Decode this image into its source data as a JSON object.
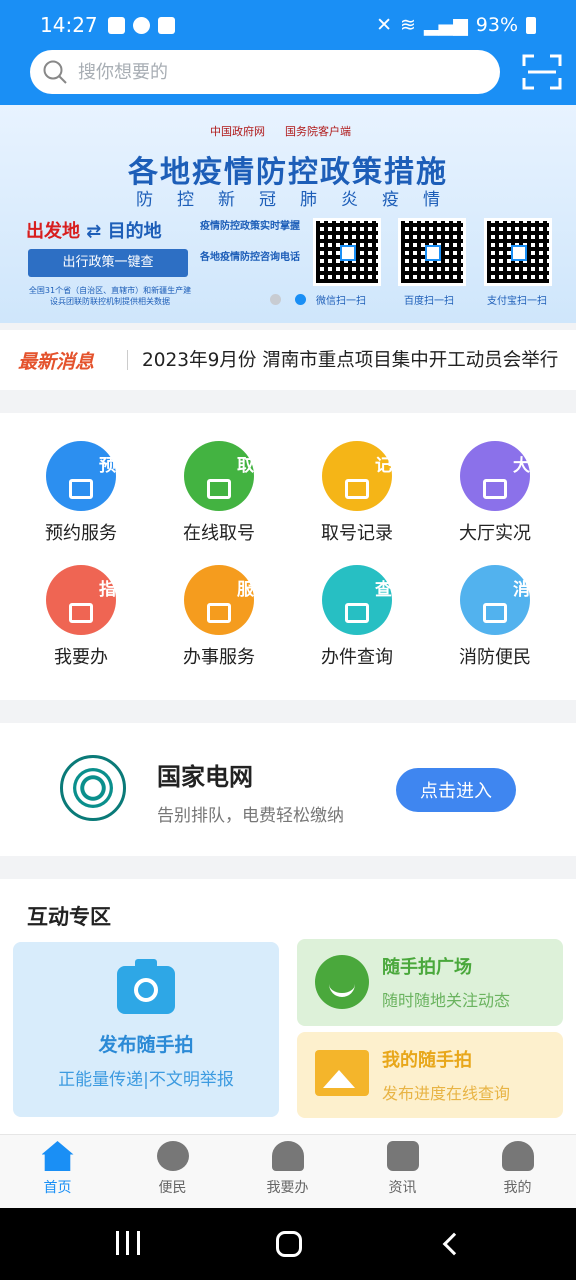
{
  "status_bar": {
    "time": "14:27",
    "battery": "93%"
  },
  "search": {
    "placeholder": "搜你想要的"
  },
  "banner": {
    "gov_site": "中国政府网",
    "state_council": "国务院客户端",
    "title": "各地疫情防控政策措施",
    "subtitle": "防控新冠肺炎疫情",
    "origin": "出发地",
    "destination": "目的地",
    "one_click": "出行政策一键查",
    "footnote": "全国31个省（自治区、直辖市）和新疆生产建设兵团联防联控机制提供相关数据",
    "policy_line": "疫情防控政策实时掌握",
    "phone_line": "各地疫情防控咨询电话",
    "qr_labels": [
      "微信扫一扫",
      "百度扫一扫",
      "支付宝扫一扫"
    ]
  },
  "news": {
    "tag": "最新消息",
    "text": "2023年9月份 渭南市重点项目集中开工动员会举行"
  },
  "services": [
    {
      "label": "预约服务",
      "icon_text": "预约",
      "color": "#2c8ff0"
    },
    {
      "label": "在线取号",
      "icon_text": "取号",
      "color": "#43b341"
    },
    {
      "label": "取号记录",
      "icon_text": "记录",
      "color": "#f5b517"
    },
    {
      "label": "大厅实况",
      "icon_text": "大厅",
      "color": "#8b71ea"
    },
    {
      "label": "我要办",
      "icon_text": "指南",
      "color": "#ef6553"
    },
    {
      "label": "办事服务",
      "icon_text": "服务",
      "color": "#f59c1e"
    },
    {
      "label": "办件查询",
      "icon_text": "查询",
      "color": "#27bfc3"
    },
    {
      "label": "消防便民",
      "icon_text": "消防",
      "color": "#52b2ee"
    }
  ],
  "grid_card": {
    "title": "国家电网",
    "subtitle": "告别排队，电费轻松缴纳",
    "button": "点击进入"
  },
  "interaction": {
    "heading": "互动专区",
    "publish": {
      "title": "发布随手拍",
      "subtitle": "正能量传递|不文明举报"
    },
    "square": {
      "title": "随手拍广场",
      "subtitle": "随时随地关注动态",
      "color": "#4aa83c"
    },
    "mine": {
      "title": "我的随手拍",
      "subtitle": "发布进度在线查询",
      "color": "#f0b022"
    }
  },
  "tabs": [
    "首页",
    "便民",
    "我要办",
    "资讯",
    "我的"
  ]
}
